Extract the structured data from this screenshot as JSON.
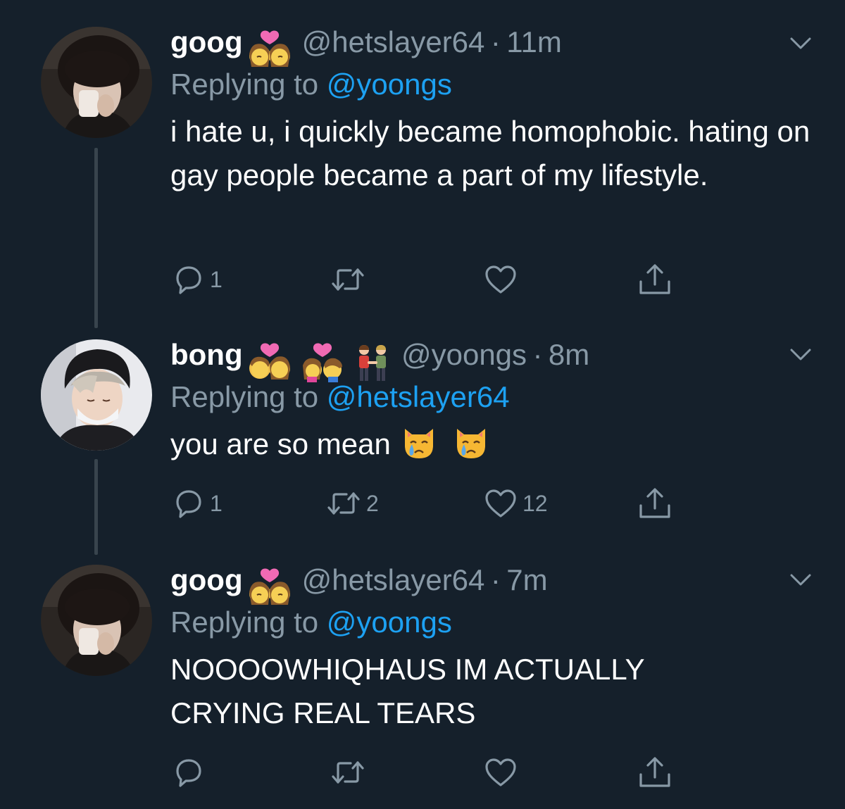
{
  "theme": {
    "background": "#15202b",
    "text": "#ffffff",
    "muted": "#8899a6",
    "link": "#1da1f2",
    "thread_line": "#38444d"
  },
  "tweets": [
    {
      "display_name": "goog",
      "name_emojis": [
        "kiss-woman-woman-emoji"
      ],
      "handle": "@hetslayer64",
      "time_separator": "·",
      "time": "11m",
      "replying_prefix": "Replying to",
      "replying_to": "@yoongs",
      "text": "i hate u, i quickly became homophobic. hating on gay people became a part of my lifestyle.",
      "text_emojis": [],
      "actions": {
        "reply_count": "1",
        "retweet_count": "",
        "like_count": "",
        "share_count": ""
      }
    },
    {
      "display_name": "bong",
      "name_emojis": [
        "kiss-woman-man-emoji",
        "couple-with-heart-emoji",
        "men-holding-hands-emoji"
      ],
      "handle": "@yoongs",
      "time_separator": "·",
      "time": "8m",
      "replying_prefix": "Replying to",
      "replying_to": "@hetslayer64",
      "text": "you are so mean",
      "text_emojis": [
        "crying-cat-emoji",
        "crying-cat-emoji"
      ],
      "actions": {
        "reply_count": "1",
        "retweet_count": "2",
        "like_count": "12",
        "share_count": ""
      }
    },
    {
      "display_name": "goog",
      "name_emojis": [
        "kiss-woman-woman-emoji"
      ],
      "handle": "@hetslayer64",
      "time_separator": "·",
      "time": "7m",
      "replying_prefix": "Replying to",
      "replying_to": "@yoongs",
      "text": "NOOOOWHIQHAUS IM ACTUALLY CRYING REAL TEARS",
      "text_emojis": [],
      "actions": {
        "reply_count": "",
        "retweet_count": "",
        "like_count": "",
        "share_count": ""
      }
    }
  ]
}
